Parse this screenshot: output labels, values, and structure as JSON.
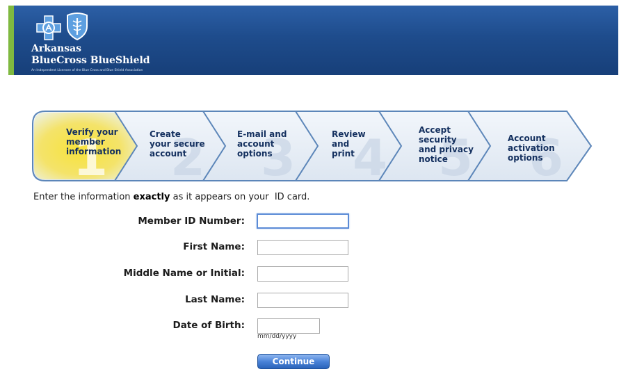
{
  "brand": {
    "name_line1": "Arkansas",
    "name_line2": "BlueCross BlueShield",
    "tagline": "An Independent Licensee of the Blue Cross and Blue Shield Association",
    "primary_color": "#1e4c8c",
    "accent_color": "#7fb940"
  },
  "steps": [
    {
      "number": "1",
      "label": "Verify your\nmember\ninformation",
      "active": true
    },
    {
      "number": "2",
      "label": "Create\nyour secure\naccount",
      "active": false
    },
    {
      "number": "3",
      "label": "E-mail and\naccount\noptions",
      "active": false
    },
    {
      "number": "4",
      "label": "Review\nand\nprint",
      "active": false
    },
    {
      "number": "5",
      "label": "Accept\nsecurity\nand privacy\nnotice",
      "active": false
    },
    {
      "number": "6",
      "label": "Account\nactivation\noptions",
      "active": false
    }
  ],
  "intro": {
    "before": "Enter the information ",
    "emphasis": "exactly",
    "after": " as it appears on your  ID card."
  },
  "form": {
    "member_id_label": "Member ID Number:",
    "member_id_value": "",
    "first_name_label": "First Name:",
    "first_name_value": "",
    "middle_name_label": "Middle Name or Initial:",
    "middle_name_value": "",
    "last_name_label": "Last Name:",
    "last_name_value": "",
    "dob_label": "Date of Birth:",
    "dob_value": "",
    "dob_hint": "mm/dd/yyyy",
    "continue_label": "Continue"
  }
}
